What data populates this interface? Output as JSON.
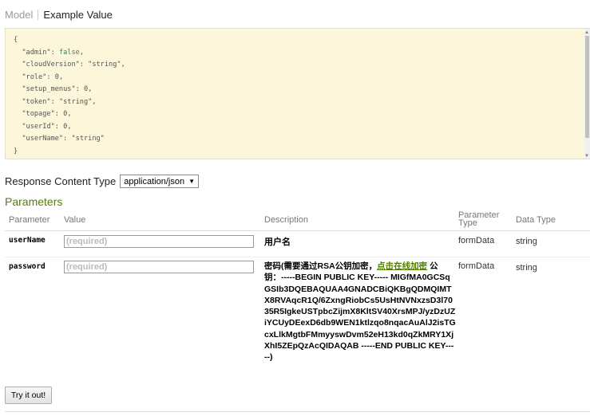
{
  "tabs": {
    "model": "Model",
    "example": "Example Value"
  },
  "example_json": {
    "open": "{",
    "close": "}",
    "lines": [
      {
        "key": "\"admin\"",
        "value": "false",
        "kind": "b",
        "comma": ","
      },
      {
        "key": "\"cloudVersion\"",
        "value": "\"string\"",
        "kind": "s",
        "comma": ","
      },
      {
        "key": "\"role\"",
        "value": "0",
        "kind": "n",
        "comma": ","
      },
      {
        "key": "\"setup_menus\"",
        "value": "0",
        "kind": "n",
        "comma": ","
      },
      {
        "key": "\"token\"",
        "value": "\"string\"",
        "kind": "s",
        "comma": ","
      },
      {
        "key": "\"topage\"",
        "value": "0",
        "kind": "n",
        "comma": ","
      },
      {
        "key": "\"userId\"",
        "value": "0",
        "kind": "n",
        "comma": ","
      },
      {
        "key": "\"userName\"",
        "value": "\"string\"",
        "kind": "s",
        "comma": ""
      }
    ]
  },
  "response_content_type": {
    "label": "Response Content Type",
    "selected": "application/json"
  },
  "parameters": {
    "title": "Parameters",
    "headers": {
      "parameter": "Parameter",
      "value": "Value",
      "description": "Description",
      "param_type_1": "Parameter",
      "param_type_2": "Type",
      "data_type": "Data Type"
    },
    "rows": [
      {
        "name": "userName",
        "placeholder": "(required)",
        "description": "用户名",
        "param_type": "formData",
        "data_type": "string"
      },
      {
        "name": "password",
        "placeholder": "(required)",
        "description_pre": "密码(需要通过RSA公钥加密，",
        "description_link": "点击在线加密",
        "description_post": " 公钥：-----BEGIN PUBLIC KEY----- MIGfMA0GCSqGSIb3DQEBAQUAA4GNADCBiQKBgQDMQIMTX8RVAqcR1Q/6ZxngRiobCs5UsHtNVNxzsD3l7035R5IgkeUSTpbcZijmX8KltSV40XrsMPJ/yzDzUZiYCUyDEexD6db9WEN1ktlzqo8nqacAuAlJ2isTGcxLlkMgtbFMmyyswDvm52eH13kd0qZkMRY1XjXhI5ZEpQzAcQIDAQAB -----END PUBLIC KEY-----)",
        "param_type": "formData",
        "data_type": "string"
      }
    ]
  },
  "try_button": "Try it out!"
}
